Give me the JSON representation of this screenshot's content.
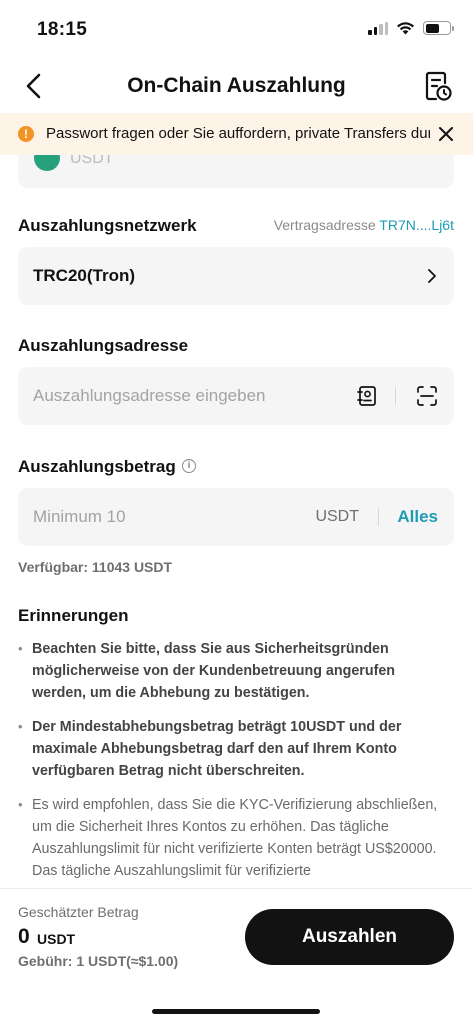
{
  "status_bar": {
    "time": "18:15"
  },
  "nav": {
    "title": "On-Chain Auszahlung"
  },
  "notice": {
    "text": "Passwort fragen oder Sie auffordern, private Transfers durchzuführen."
  },
  "network": {
    "label": "Auszahlungsnetzwerk",
    "contract_label": "Vertragsadresse",
    "contract_address": "TR7N....Lj6t",
    "value": "TRC20(Tron)"
  },
  "address": {
    "label": "Auszahlungsadresse",
    "placeholder": "Auszahlungsadresse eingeben"
  },
  "amount": {
    "label": "Auszahlungsbetrag",
    "placeholder": "Minimum 10",
    "unit": "USDT",
    "all_label": "Alles",
    "available": "Verfügbar: 11043 USDT"
  },
  "reminders": {
    "title": "Erinnerungen",
    "items": [
      "Beachten Sie bitte, dass Sie aus Sicherheitsgründen möglicherweise von der Kundenbetreuung angerufen werden, um die Abhebung zu bestätigen.",
      "Der Mindestabhebungsbetrag beträgt 10USDT und der maximale Abhebungsbetrag darf den auf Ihrem Konto verfügbaren Betrag nicht überschreiten.",
      "Es wird empfohlen, dass Sie die KYC-Verifizierung abschließen, um die Sicherheit Ihres Kontos zu erhöhen. Das tägliche Auszahlungslimit für nicht verifizierte Konten beträgt US$20000. Das tägliche Auszahlungslimit für verifizierte"
    ]
  },
  "footer": {
    "estimate_label": "Geschätzter Betrag",
    "estimate_value": "0",
    "estimate_unit": "USDT",
    "fee": "Gebühr: 1 USDT(≈$1.00)",
    "submit_label": "Auszahlen"
  },
  "colors": {
    "accent": "#1d9bb5",
    "warning": "#f39324",
    "button": "#121212"
  }
}
